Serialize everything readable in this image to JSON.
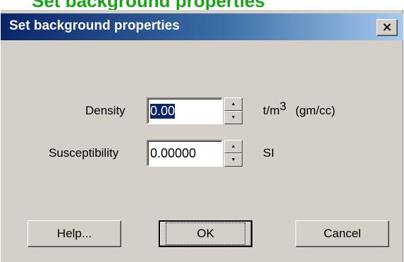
{
  "banner": {
    "text": "Set background properties"
  },
  "dialog": {
    "title": "Set background properties",
    "close_label": "×"
  },
  "fields": {
    "density": {
      "label": "Density",
      "value": "0.00",
      "unit": "t/m",
      "unit_exp": "3",
      "unit_extra": "(gm/cc)"
    },
    "susceptibility": {
      "label": "Susceptibility",
      "value": "0.00000",
      "unit": "SI"
    }
  },
  "buttons": {
    "help": "Help...",
    "ok": "OK",
    "cancel": "Cancel"
  },
  "icons": {
    "spin_up": "spin-up-arrow-icon",
    "spin_down": "spin-down-arrow-icon",
    "close": "close-icon"
  }
}
